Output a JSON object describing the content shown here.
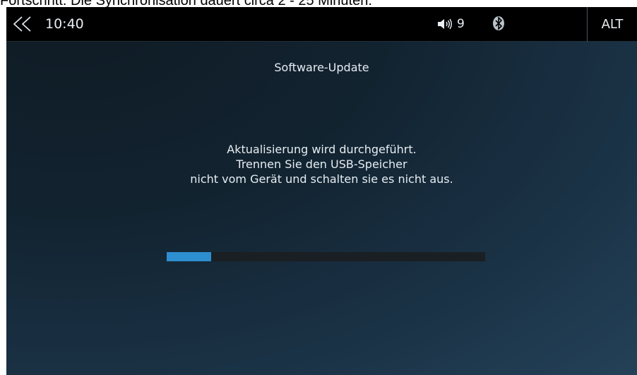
{
  "caption": "Fortschritt. Die Synchronisation dauert circa 2 - 25 Minuten.",
  "statusbar": {
    "back_icon": "double-chevron-left-icon",
    "time": "10:40",
    "volume_icon": "speaker-icon",
    "volume_level": "9",
    "bluetooth_icon": "bluetooth-icon",
    "alt_label": "ALT"
  },
  "screen": {
    "title": "Software-Update",
    "message_lines": [
      "Aktualisierung wird durchgeführt.",
      "Trennen Sie den USB-Speicher",
      "nicht vom Gerät und schalten sie es nicht aus."
    ],
    "progress_fraction": 0.14
  },
  "colors": {
    "progress": "#2e8fd0",
    "track": "#1a1f23",
    "statusbar": "#000000"
  }
}
